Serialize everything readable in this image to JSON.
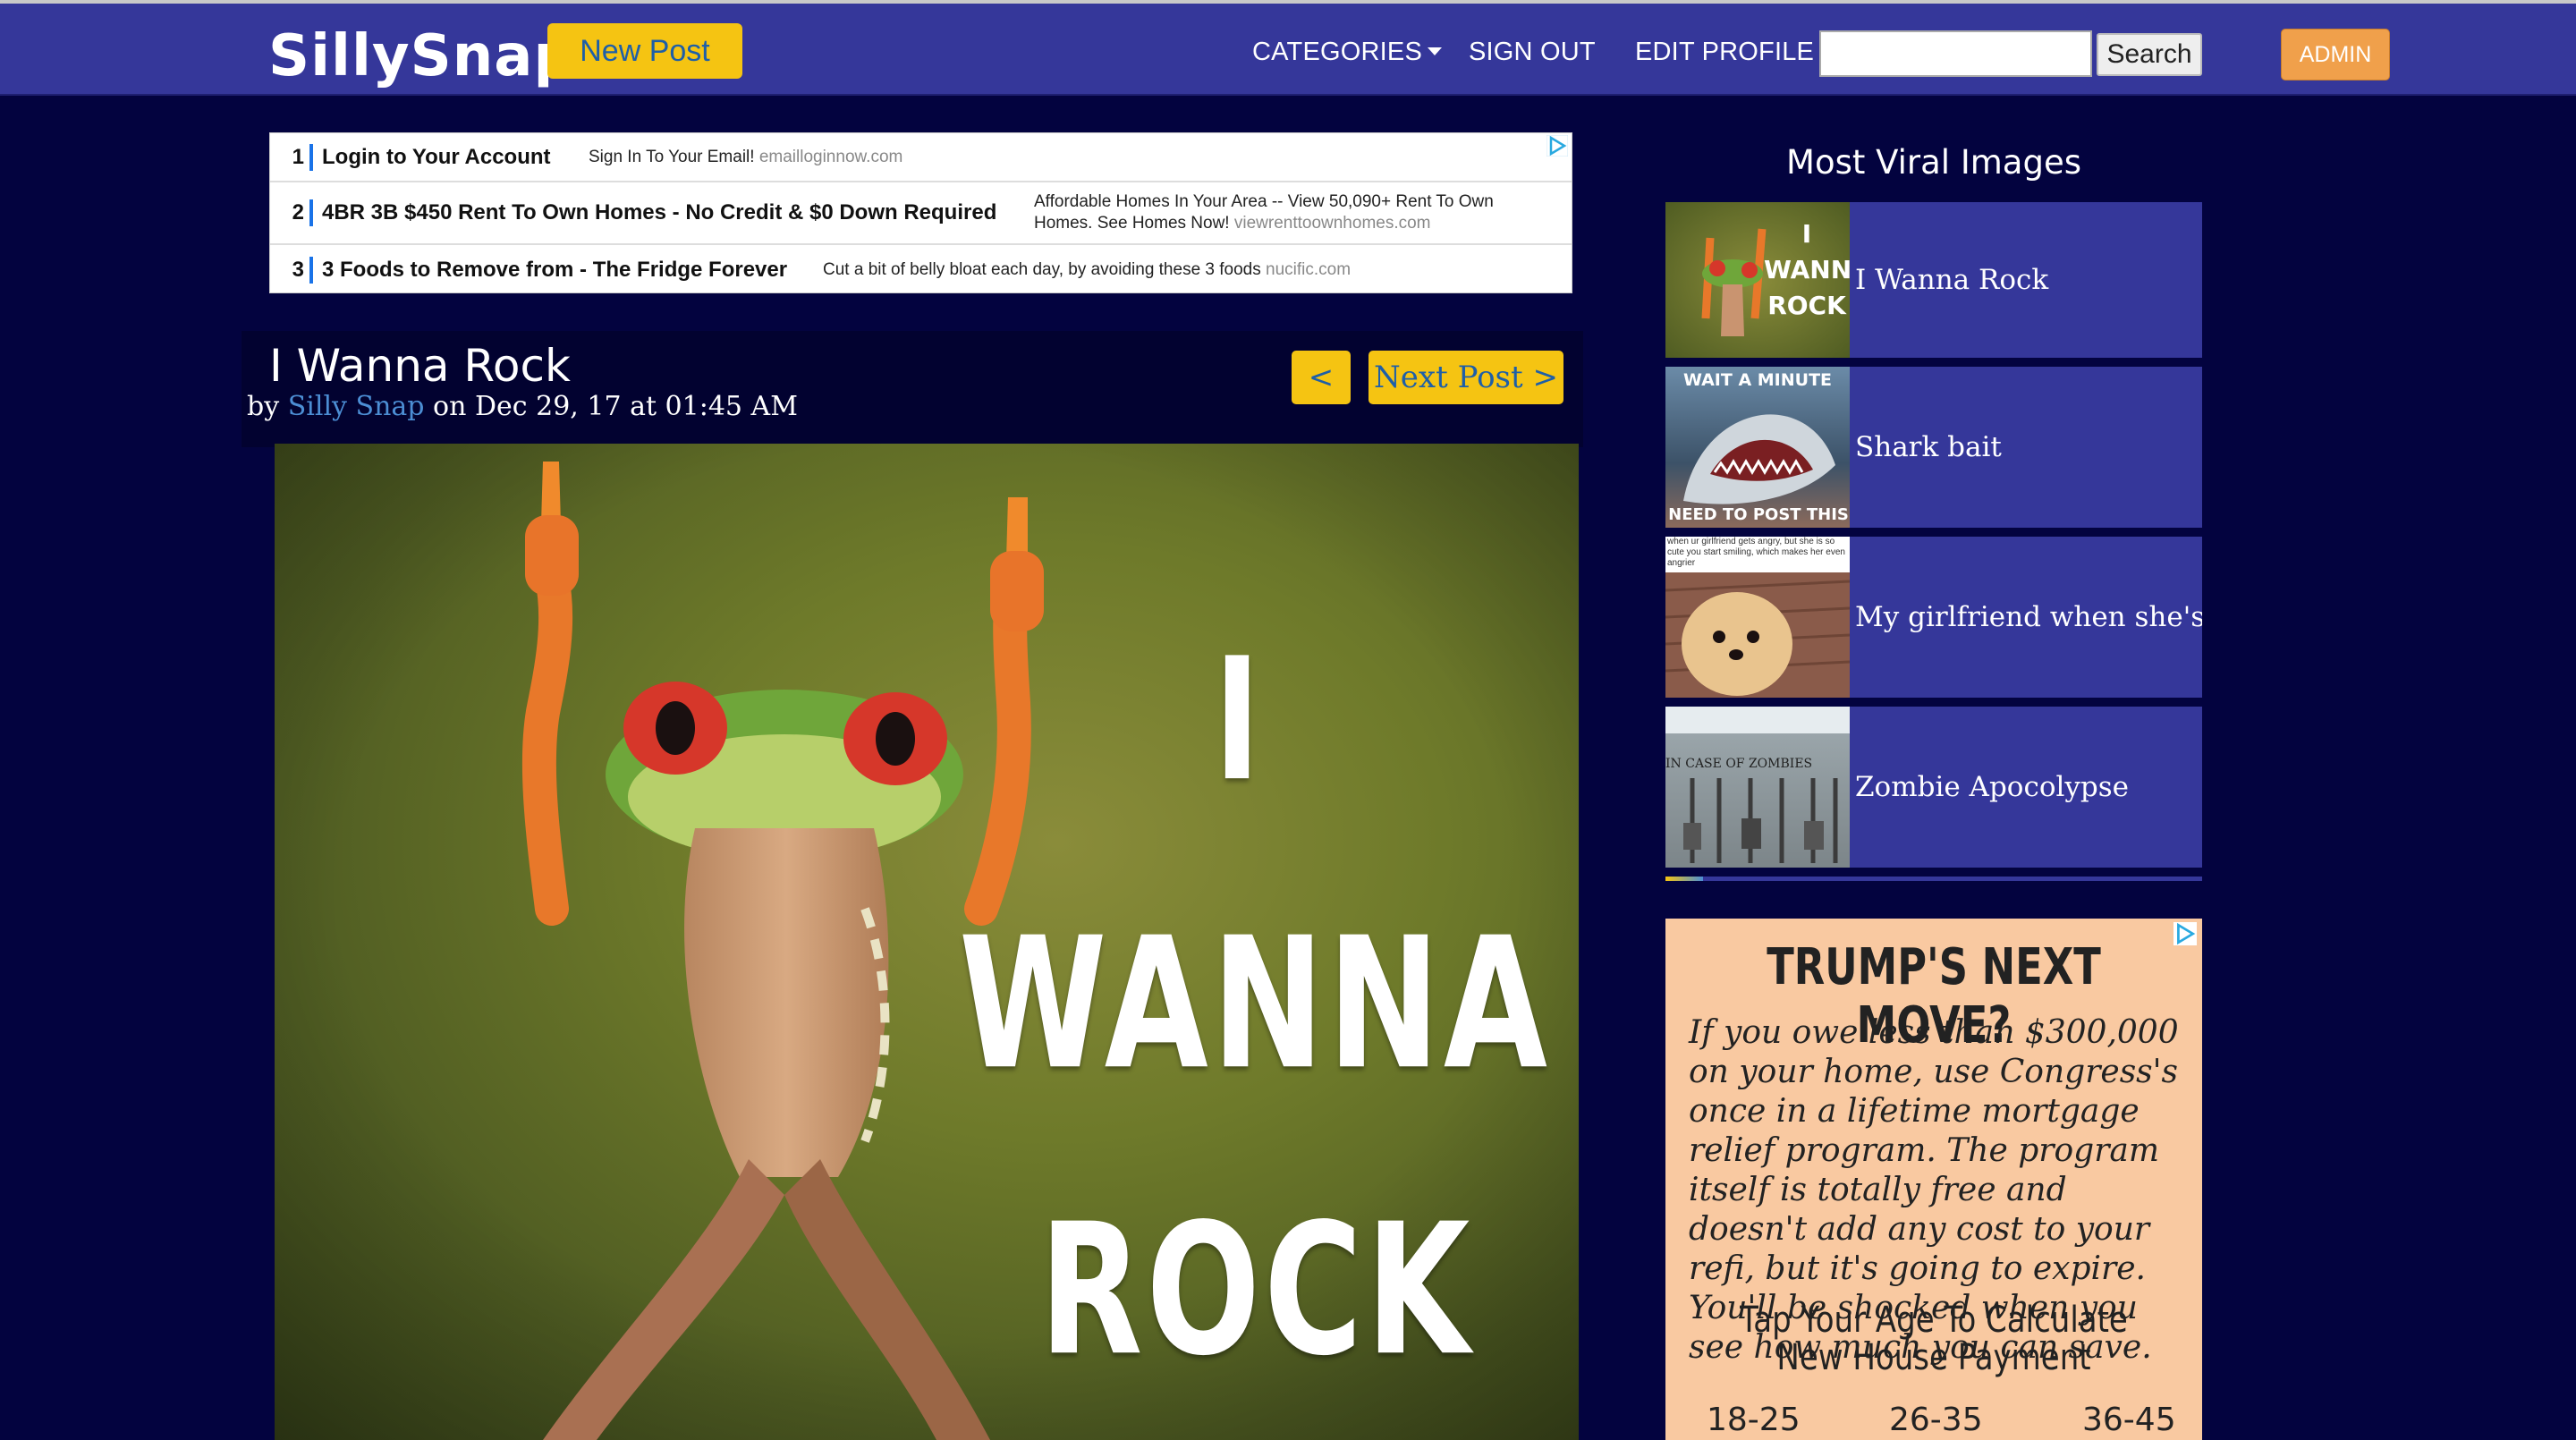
{
  "navbar": {
    "brand": "SillySnap",
    "new_post": "New Post",
    "categories": "CATEGORIES",
    "sign_out": "SIGN OUT",
    "edit_profile": "EDIT PROFILE",
    "search_value": "",
    "search_button": "Search",
    "admin": "ADMIN"
  },
  "text_ads": [
    {
      "num": "1",
      "title": "Login to Your Account",
      "desc": "Sign In To Your Email!",
      "url": "emailloginnow.com"
    },
    {
      "num": "2",
      "title": "4BR 3B $450 Rent To Own Homes - No Credit & $0 Down Required",
      "desc": "Affordable Homes In Your Area -- View 50,090+ Rent To Own Homes. See Homes Now!",
      "url": "viewrenttoownhomes.com"
    },
    {
      "num": "3",
      "title": "3 Foods to Remove from - The Fridge Forever",
      "desc": "Cut a bit of belly bloat each day, by avoiding these 3 foods",
      "url": "nucific.com"
    }
  ],
  "post": {
    "title": "I Wanna Rock",
    "by": "by",
    "author": "Silly Snap",
    "on": "on Dec 29, 17 at 01:45 AM",
    "prev_button": "<",
    "next_button": "Next Post >",
    "image_text": [
      "I",
      "WANNA",
      "ROCK"
    ]
  },
  "sidebar": {
    "title": "Most Viral Images",
    "items": [
      {
        "label": "I Wanna Rock",
        "thumb_text": [
          "I",
          "WANNA",
          "ROCK"
        ]
      },
      {
        "label": "Shark bait",
        "thumb_text": [
          "WAIT A MINUTE",
          "NEED TO POST THIS"
        ]
      },
      {
        "label": "My girlfriend when she's angry",
        "thumb_text": [
          "when ur girlfriend gets angry, but she is so cute you start smiling, which makes her even angrier"
        ]
      },
      {
        "label": "Zombie Apocolypse",
        "thumb_text": [
          "IN CASE OF ZOMBIES"
        ]
      }
    ],
    "progress": 0.07
  },
  "side_ad": {
    "title": "TRUMP'S NEXT MOVE?",
    "body": "If you owe less than $300,000 on your home, use Congress's once in a lifetime mortgage relief program. The program itself is totally free and doesn't add any cost to your refi, but it's going to expire. You'll be shocked when you see how much you can save.",
    "cta": "Tap Your Age To Calculate New House Payment",
    "ages": [
      "18-25",
      "26-35",
      "36-45"
    ]
  },
  "colors": {
    "background": "#03033f",
    "navbar": "#35379a",
    "accent_yellow": "#f5c412",
    "admin_orange": "#f0a04b",
    "link_blue": "#4c8ed4"
  }
}
